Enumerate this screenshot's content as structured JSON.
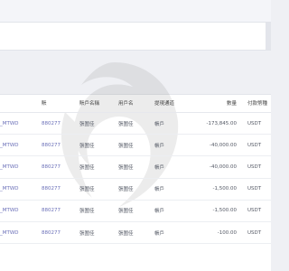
{
  "table": {
    "headers": [
      "",
      "賬",
      "賬戶名稱",
      "用戶名",
      "提現通道",
      "數量",
      "付款幣種"
    ],
    "rows": [
      {
        "code": "_MTWD",
        "account": "880277",
        "account_name": "張圍佳",
        "user_name": "張圍佳",
        "channel": "帳戶",
        "amount": "-173,845.00",
        "currency": "USDT"
      },
      {
        "code": "_MTWD",
        "account": "880277",
        "account_name": "張圍佳",
        "user_name": "張圍佳",
        "channel": "帳戶",
        "amount": "-40,000.00",
        "currency": "USDT"
      },
      {
        "code": "_MTWD",
        "account": "880277",
        "account_name": "張圍佳",
        "user_name": "張圍佳",
        "channel": "帳戶",
        "amount": "-40,000.00",
        "currency": "USDT"
      },
      {
        "code": "_MTWD",
        "account": "880277",
        "account_name": "張圍佳",
        "user_name": "張圍佳",
        "channel": "帳戶",
        "amount": "-1,500.00",
        "currency": "USDT"
      },
      {
        "code": "_MTWD",
        "account": "880277",
        "account_name": "張圍佳",
        "user_name": "張圍佳",
        "channel": "帳戶",
        "amount": "-1,500.00",
        "currency": "USDT"
      },
      {
        "code": "_MTWD",
        "account": "880277",
        "account_name": "張圍佳",
        "user_name": "張圍佳",
        "channel": "帳戶",
        "amount": "-100.00",
        "currency": "USDT"
      }
    ]
  },
  "colors": {
    "link": "#6a6fb8",
    "text": "#555a66",
    "background": "#eff0f4"
  }
}
